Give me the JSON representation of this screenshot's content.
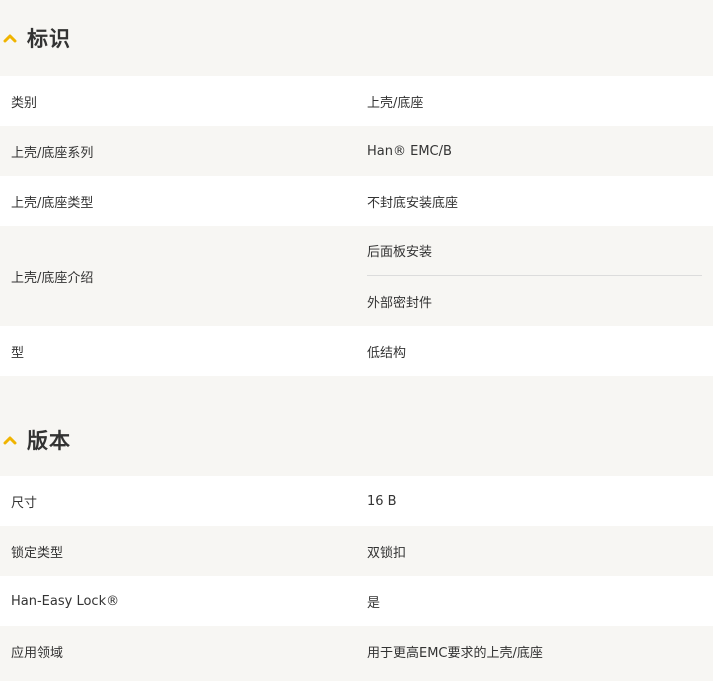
{
  "sections": [
    {
      "title": "标识",
      "rows": [
        {
          "label": "类别",
          "value": "上壳/底座"
        },
        {
          "label": "上壳/底座系列",
          "value": "Han® EMC/B"
        },
        {
          "label": "上壳/底座类型",
          "value": "不封底安装底座"
        },
        {
          "label": "上壳/底座介绍",
          "values": [
            "后面板安装",
            "外部密封件"
          ]
        },
        {
          "label": "型",
          "value": "低结构"
        }
      ]
    },
    {
      "title": "版本",
      "rows": [
        {
          "label": "尺寸",
          "value": "16 B"
        },
        {
          "label": "锁定类型",
          "value": "双锁扣"
        },
        {
          "label": "Han-Easy Lock®",
          "value": "是"
        },
        {
          "label": "应用领域",
          "value": "用于更高EMC要求的上壳/底座"
        }
      ]
    }
  ],
  "colors": {
    "accent": "#f0b400",
    "row_white": "#ffffff",
    "row_grey": "#f7f6f3",
    "text": "#333333"
  },
  "icons": {
    "section_toggle": "chevron-up-icon"
  }
}
